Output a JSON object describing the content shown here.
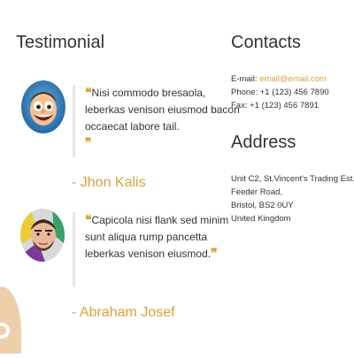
{
  "testimonial": {
    "heading": "Testimonial",
    "items": [
      {
        "quote": "Nisi commodo bresaola, leberkas venison eiusmod bacon occaecat labore tail.",
        "author": "- Jhon Kalis",
        "avatar_icon": "cartoon-face-avatar"
      },
      {
        "quote": "Capicola nisi flank sed minim sunt aliqua rump pancetta leberkas venison eiusmod.",
        "author": "- Abraham Josef",
        "avatar_icon": "bearded-man-avatar"
      }
    ]
  },
  "contacts": {
    "heading": "Contacts",
    "email_label": "E-mail: ",
    "email_value": "email@email.com",
    "phone": "Phone: +1 (123) 456 7890",
    "fax": "Fax: +1 (123) 456 7891"
  },
  "address": {
    "heading": "Address",
    "lines": [
      "Unit C2, St.Vincent's Trading Est.,",
      "Feeder Road,",
      "Bristol, BS2 0UY",
      "United Kingdom"
    ]
  },
  "colors": {
    "accent": "#d9a13a",
    "text": "#333333",
    "quote_border": "#e6e6e6"
  },
  "decorations": {
    "open_quote_glyph": "❝",
    "close_quote_glyph": "❞",
    "corner_icon": "logo-partial-icon"
  }
}
